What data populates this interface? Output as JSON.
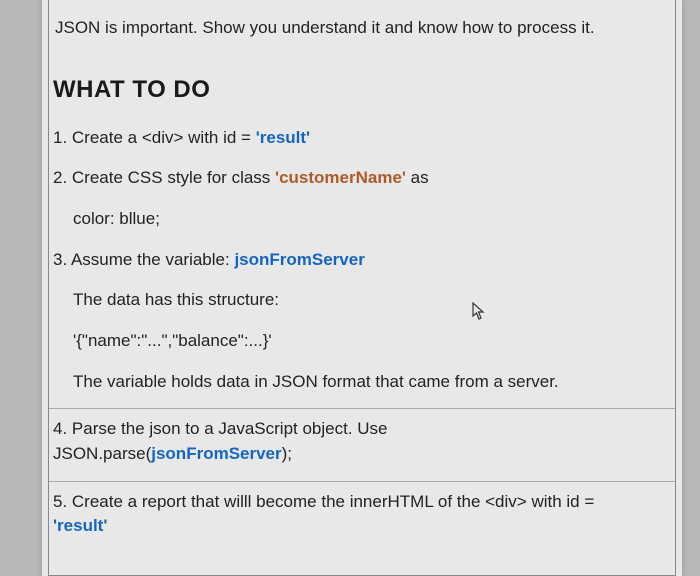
{
  "intro": "JSON is important. Show you understand it and know how to process it.",
  "heading": "WHAT TO DO",
  "step1": {
    "pre": "1. Create a <div> with id = ",
    "hl": "'result'"
  },
  "step2": {
    "pre": "2. Create CSS style for class ",
    "hl": "'customerName'",
    "post": " as",
    "sub": "color: bllue;"
  },
  "step3": {
    "pre": "3. Assume the variable: ",
    "hl": "jsonFromServer",
    "sub1": "The data has this structure:",
    "sub2": "'{\"name\":\"...\",\"balance\":...}'",
    "sub3": "The variable holds data in JSON format that came from a server."
  },
  "step4": {
    "line1": "4. Parse the json to a JavaScript object. Use",
    "line2pre": "JSON.parse(",
    "line2hl": "jsonFromServer",
    "line2post": ");"
  },
  "step5": {
    "pre": "5. Create a report that willl become the innerHTML of the <div> with id = ",
    "hl": "'result'"
  }
}
